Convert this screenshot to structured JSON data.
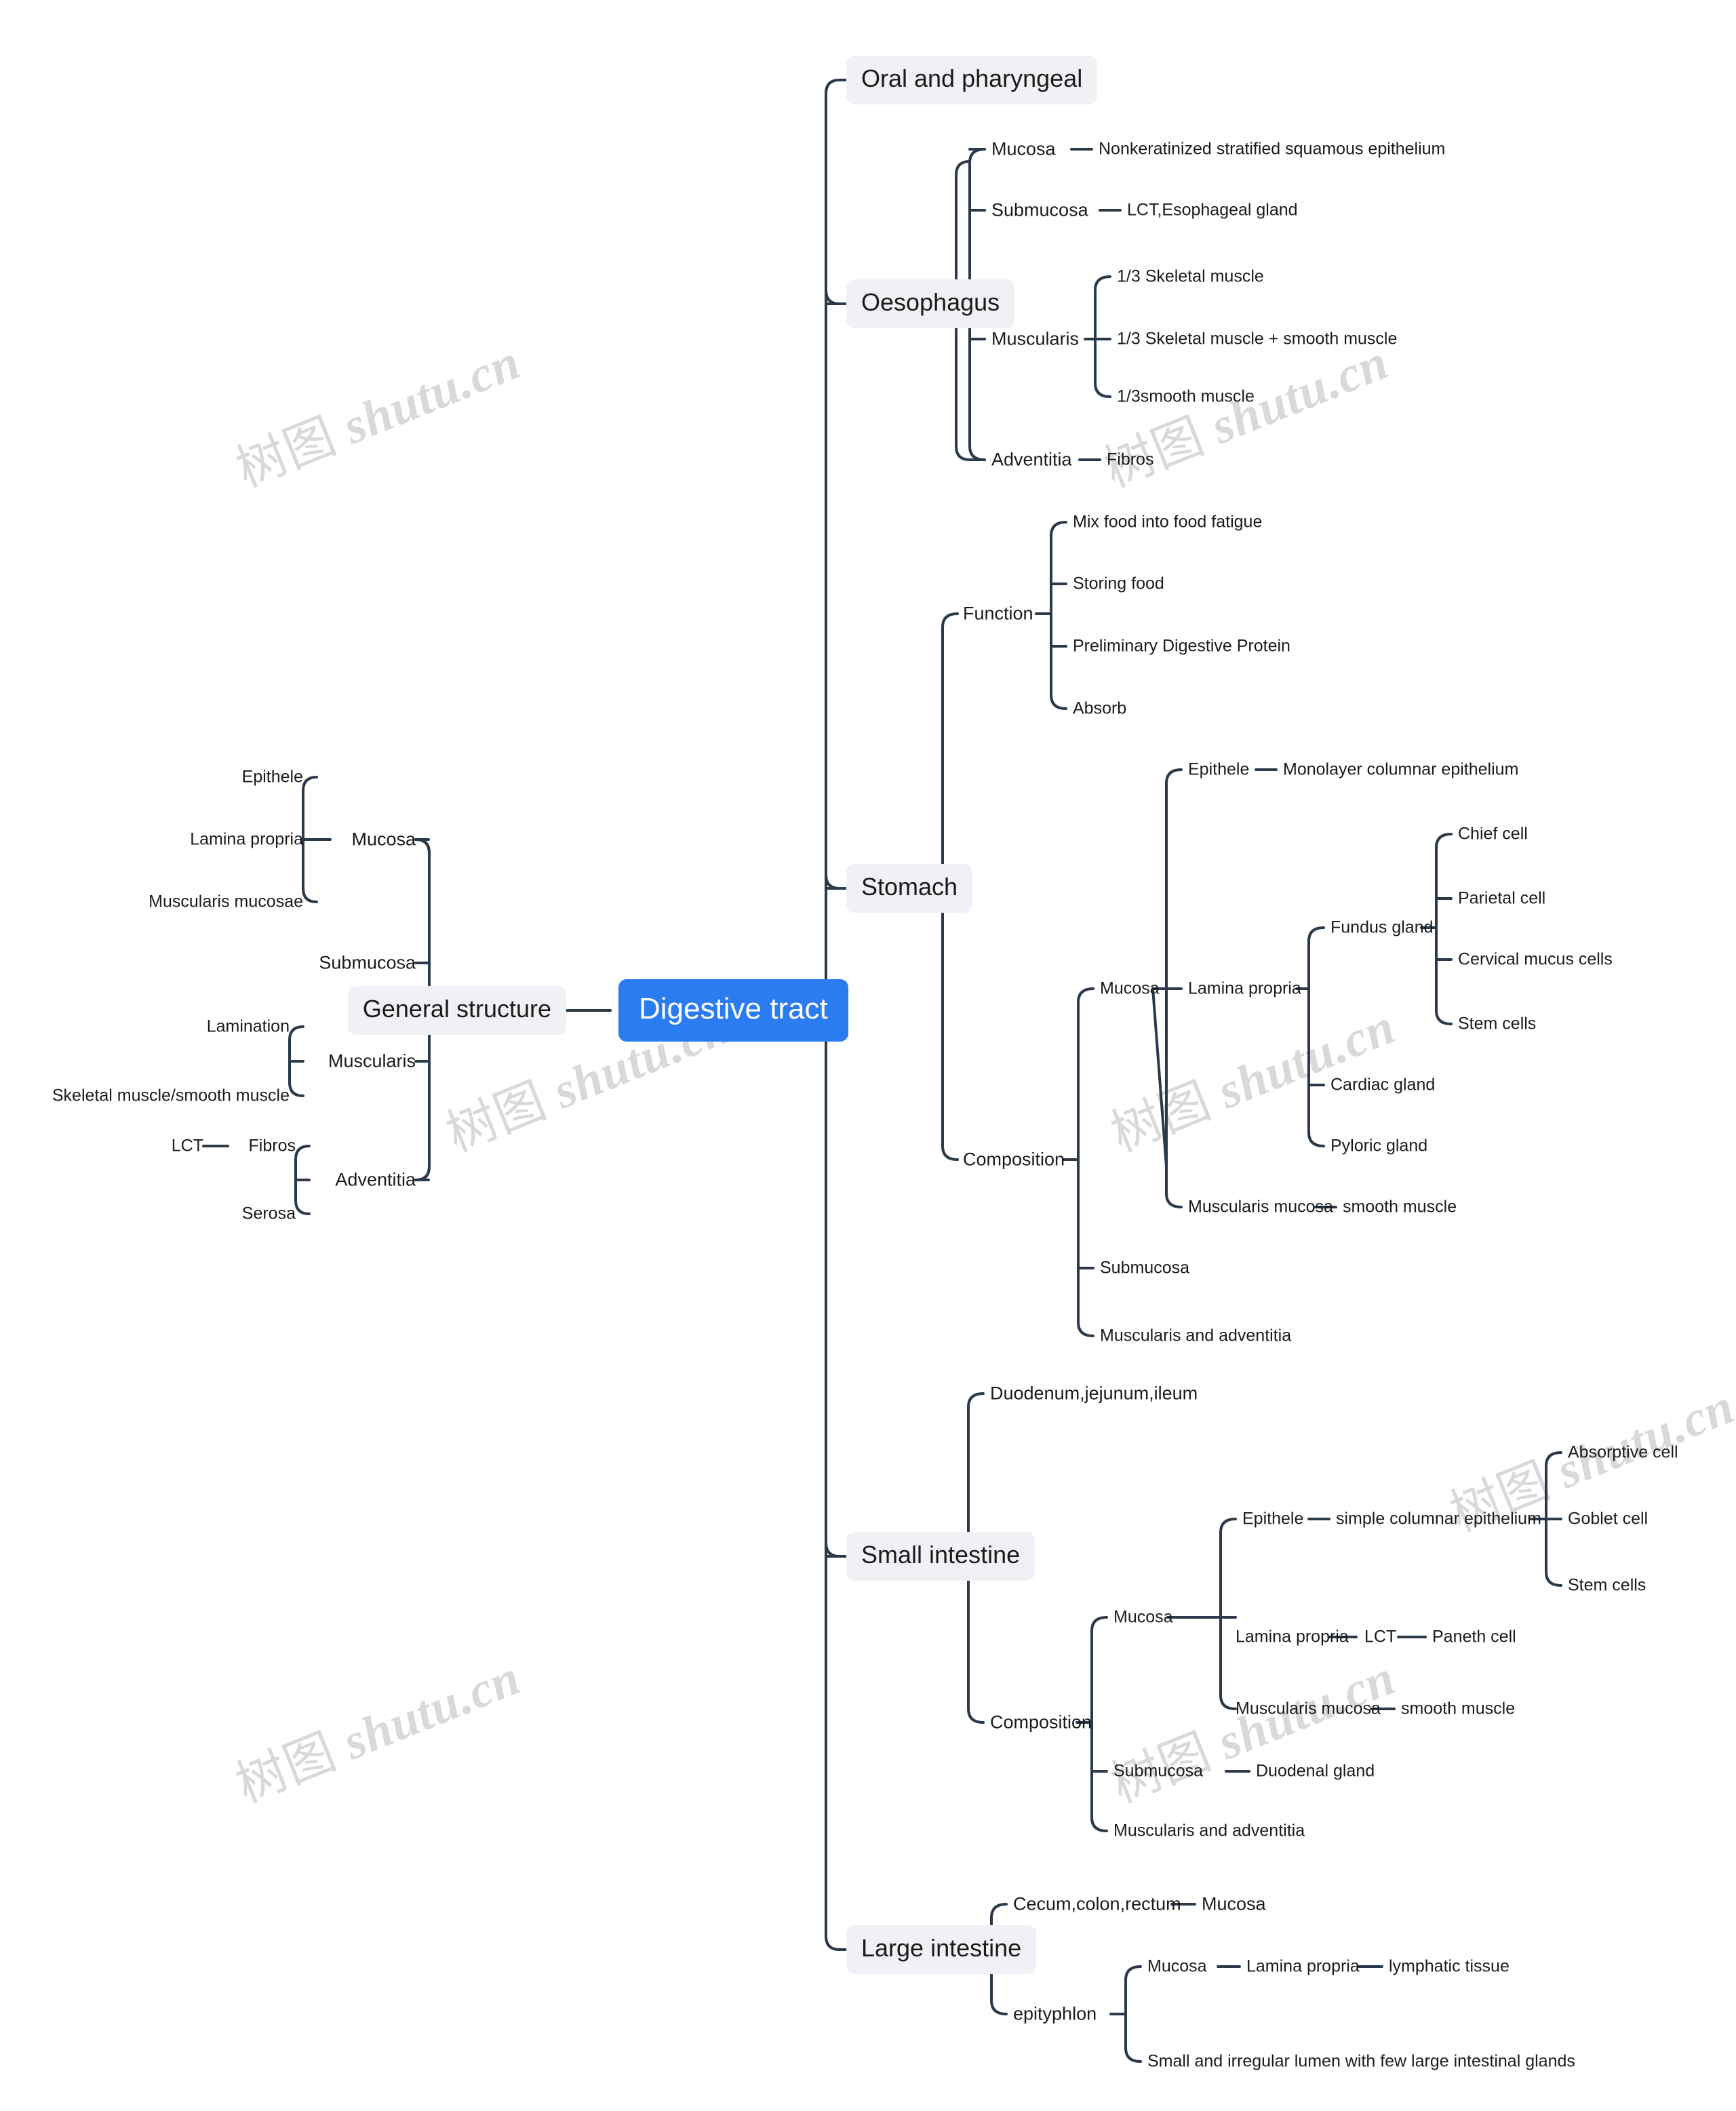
{
  "meta": {
    "diagram_title": "Digestive tract",
    "accent_color": "#2b7cf0",
    "branch_bg_color": "#eff1f4",
    "line_color": "#2b3a4a",
    "watermark_text": "树图 shutu.cn"
  },
  "root": {
    "label": "Digestive tract"
  },
  "watermarks": [
    {
      "text": "树图 shutu.cn"
    },
    {
      "text": "树图 shutu.cn"
    },
    {
      "text": "树图 shutu.cn"
    },
    {
      "text": "树图 shutu.cn"
    },
    {
      "text": "树图 shutu.cn"
    },
    {
      "text": "树图 shutu.cn"
    },
    {
      "text": "树图 shutu.cn"
    }
  ],
  "left_branch": {
    "label": "General structure",
    "children": [
      {
        "label": "Mucosa",
        "children": [
          {
            "label": "Epithele"
          },
          {
            "label": "Lamina propria"
          },
          {
            "label": "Muscularis mucosae"
          }
        ]
      },
      {
        "label": "Submucosa",
        "children": []
      },
      {
        "label": "Muscularis",
        "children": [
          {
            "label": "Lamination"
          },
          {
            "label": "Skeletal muscle/smooth muscle"
          }
        ]
      },
      {
        "label": "Adventitia",
        "children": [
          {
            "label": "Fibros",
            "children": [
              {
                "label": "LCT"
              }
            ]
          },
          {
            "label": "Serosa"
          }
        ]
      }
    ]
  },
  "right_branches": [
    {
      "label": "Oral and pharyngeal",
      "children": []
    },
    {
      "label": "Oesophagus",
      "children": [
        {
          "label": "Mucosa",
          "children": [
            {
              "label": "Nonkeratinized stratified squamous epithelium"
            }
          ]
        },
        {
          "label": "Submucosa",
          "children": [
            {
              "label": "LCT,Esophageal gland"
            }
          ]
        },
        {
          "label": "Muscularis",
          "children": [
            {
              "label": "1/3 Skeletal muscle"
            },
            {
              "label": "1/3 Skeletal muscle + smooth muscle"
            },
            {
              "label": "1/3smooth muscle"
            }
          ]
        },
        {
          "label": "Adventitia",
          "children": [
            {
              "label": "Fibros"
            }
          ]
        }
      ]
    },
    {
      "label": "Stomach",
      "children": [
        {
          "label": "Function",
          "children": [
            {
              "label": "Mix food into food fatigue"
            },
            {
              "label": "Storing food"
            },
            {
              "label": "Preliminary Digestive Protein"
            },
            {
              "label": "Absorb"
            }
          ]
        },
        {
          "label": "Composition",
          "children": [
            {
              "label": "Mucosa",
              "children": [
                {
                  "label": "Epithele",
                  "children": [
                    {
                      "label": "Monolayer columnar epithelium"
                    }
                  ]
                },
                {
                  "label": "Lamina propria",
                  "children": [
                    {
                      "label": "Fundus gland",
                      "children": [
                        {
                          "label": "Chief cell"
                        },
                        {
                          "label": "Parietal cell"
                        },
                        {
                          "label": "Cervical mucus cells"
                        },
                        {
                          "label": "Stem cells"
                        }
                      ]
                    },
                    {
                      "label": "Cardiac gland"
                    },
                    {
                      "label": "Pyloric gland"
                    }
                  ]
                },
                {
                  "label": "Muscularis mucosa",
                  "children": [
                    {
                      "label": "smooth muscle"
                    }
                  ]
                }
              ]
            },
            {
              "label": "Submucosa"
            },
            {
              "label": "Muscularis and adventitia"
            }
          ]
        }
      ]
    },
    {
      "label": "Small intestine",
      "children": [
        {
          "label": "Duodenum,jejunum,ileum"
        },
        {
          "label": "Composition",
          "children": [
            {
              "label": "Mucosa",
              "children": [
                {
                  "label": "Epithele",
                  "children": [
                    {
                      "label": "simple columnar epithelium",
                      "children": [
                        {
                          "label": "Absorptive cell"
                        },
                        {
                          "label": "Goblet cell"
                        },
                        {
                          "label": "Stem cells"
                        }
                      ]
                    }
                  ]
                },
                {
                  "label": "Lamina propria",
                  "children": [
                    {
                      "label": "LCT",
                      "children": [
                        {
                          "label": "Paneth cell"
                        }
                      ]
                    }
                  ]
                },
                {
                  "label": "Muscularis mucosa",
                  "children": [
                    {
                      "label": "smooth muscle"
                    }
                  ]
                }
              ]
            },
            {
              "label": "Submucosa",
              "children": [
                {
                  "label": "Duodenal gland"
                }
              ]
            },
            {
              "label": "Muscularis and adventitia"
            }
          ]
        }
      ]
    },
    {
      "label": "Large intestine",
      "children": [
        {
          "label": "Cecum,colon,rectum",
          "children": [
            {
              "label": "Mucosa"
            }
          ]
        },
        {
          "label": "epityphlon",
          "children": [
            {
              "label": "Mucosa",
              "children": [
                {
                  "label": "Lamina propria",
                  "children": [
                    {
                      "label": "lymphatic tissue"
                    }
                  ]
                }
              ]
            },
            {
              "label": "Small and irregular lumen with few large intestinal glands"
            }
          ]
        }
      ]
    }
  ],
  "labels": {
    "root": "Digestive tract",
    "gs": "General structure",
    "gs_mucosa": "Mucosa",
    "gs_epithele": "Epithele",
    "gs_lamina": "Lamina propria",
    "gs_muscmuc": "Muscularis mucosae",
    "gs_submucosa": "Submucosa",
    "gs_muscularis": "Muscularis",
    "gs_lamination": "Lamination",
    "gs_skel": "Skeletal muscle/smooth muscle",
    "gs_adventitia": "Adventitia",
    "gs_fibros": "Fibros",
    "gs_lct": "LCT",
    "gs_serosa": "Serosa",
    "oral": "Oral and pharyngeal",
    "oes": "Oesophagus",
    "oes_mucosa": "Mucosa",
    "oes_mucosa_d": "Nonkeratinized stratified squamous epithelium",
    "oes_sub": "Submucosa",
    "oes_sub_d": "LCT,Esophageal gland",
    "oes_musc": "Muscularis",
    "oes_m1": "1/3 Skeletal muscle",
    "oes_m2": "1/3 Skeletal muscle + smooth muscle",
    "oes_m3": "1/3smooth muscle",
    "oes_adv": "Adventitia",
    "oes_adv_d": "Fibros",
    "stomach": "Stomach",
    "st_function": "Function",
    "st_f1": "Mix food into food fatigue",
    "st_f2": "Storing food",
    "st_f3": "Preliminary Digestive Protein",
    "st_f4": "Absorb",
    "st_comp": "Composition",
    "st_mucosa": "Mucosa",
    "st_epithele": "Epithele",
    "st_epithele_d": "Monolayer columnar epithelium",
    "st_lamina": "Lamina propria",
    "st_fundus": "Fundus gland",
    "st_chief": "Chief cell",
    "st_parietal": "Parietal cell",
    "st_cervical": "Cervical mucus cells",
    "st_stem": "Stem cells",
    "st_cardiac": "Cardiac gland",
    "st_pyloric": "Pyloric gland",
    "st_muscmuc": "Muscularis mucosa",
    "st_smooth": "smooth muscle",
    "st_sub": "Submucosa",
    "st_mus_adv": "Muscularis and adventitia",
    "small": "Small intestine",
    "si_djl": "Duodenum,jejunum,ileum",
    "si_comp": "Composition",
    "si_mucosa": "Mucosa",
    "si_epithele": "Epithele",
    "si_simple": "simple columnar epithelium",
    "si_absorptive": "Absorptive cell",
    "si_goblet": "Goblet cell",
    "si_stem": "Stem cells",
    "si_lamina": "Lamina propria",
    "si_lct": "LCT",
    "si_paneth": "Paneth cell",
    "si_muscmuc": "Muscularis mucosa",
    "si_smooth": "smooth muscle",
    "si_sub": "Submucosa",
    "si_duodenal": "Duodenal gland",
    "si_mus_adv": "Muscularis and adventitia",
    "large": "Large intestine",
    "li_ccr": "Cecum,colon,rectum",
    "li_ccr_d": "Mucosa",
    "li_epityphlon": "epityphlon",
    "li_mucosa": "Mucosa",
    "li_lamina": "Lamina propria",
    "li_lymph": "lymphatic tissue",
    "li_small": "Small and irregular lumen with few large intestinal glands"
  }
}
